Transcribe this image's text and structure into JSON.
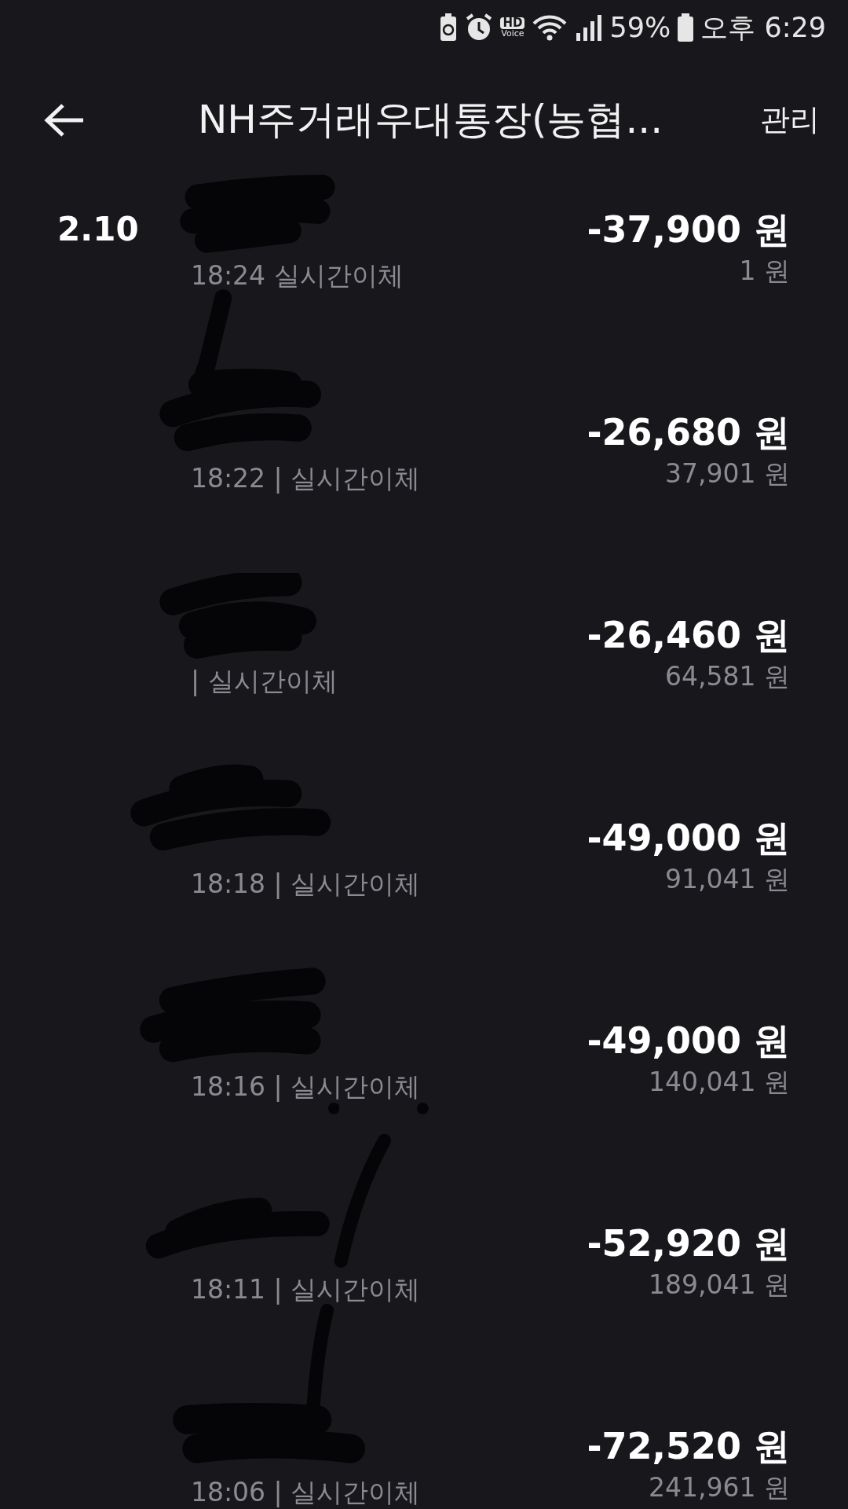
{
  "status_bar": {
    "battery": "59%",
    "time": "오후 6:29",
    "hd_label": "HD",
    "voice_label": "Voice"
  },
  "header": {
    "title": "NH주거래우대통장(농협...",
    "action": "관리"
  },
  "date": "2.10",
  "transactions": [
    {
      "time": "18:24",
      "type": "실시간이체",
      "amount": "-37,900 원",
      "balance": "1 원"
    },
    {
      "time": "18:22",
      "separator": "|",
      "type": "실시간이체",
      "amount": "-26,680 원",
      "balance": "37,901 원"
    },
    {
      "separator": "|",
      "type": "실시간이체",
      "amount": "-26,460 원",
      "balance": "64,581 원"
    },
    {
      "time": "18:18",
      "separator": "|",
      "type": "실시간이체",
      "amount": "-49,000 원",
      "balance": "91,041 원"
    },
    {
      "time": "18:16",
      "separator": "|",
      "type": "실시간이체",
      "amount": "-49,000 원",
      "balance": "140,041 원"
    },
    {
      "time": "18:11",
      "separator": "|",
      "type": "실시간이체",
      "amount": "-52,920 원",
      "balance": "189,041 원"
    },
    {
      "time": "18:06",
      "separator": "|",
      "type": "실시간이체",
      "amount": "-72,520 원",
      "balance": "241,961 원"
    }
  ]
}
